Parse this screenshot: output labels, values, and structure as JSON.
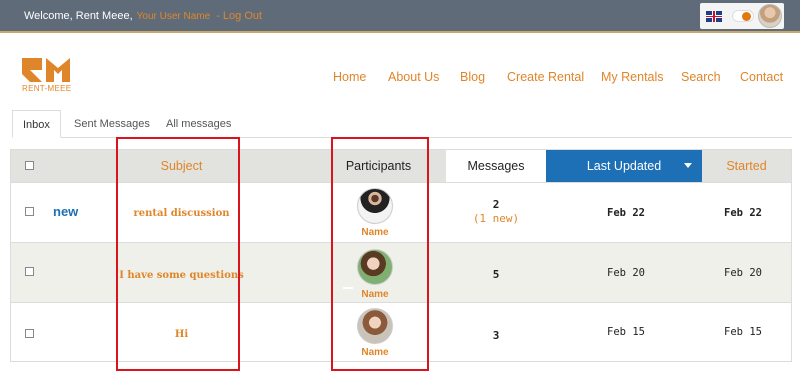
{
  "topbar": {
    "welcome": "Welcome, Rent Meee,",
    "user_name": "Your User Name",
    "logout": "- Log Out"
  },
  "logo": {
    "text": "RENT-MEEE",
    "color": "#e0862a"
  },
  "nav": {
    "items": [
      "Home",
      "About Us",
      "Blog",
      "Create Rental",
      "My Rentals",
      "Search",
      "Contact"
    ]
  },
  "tabs": {
    "items": [
      "Inbox",
      "Sent Messages",
      "All messages"
    ],
    "active": "Inbox"
  },
  "table": {
    "headers": {
      "subject": "Subject",
      "participants": "Participants",
      "messages": "Messages",
      "last_updated": "Last Updated",
      "started": "Started"
    },
    "rows": [
      {
        "badge": "new",
        "subject": "rental discussion",
        "participant": "Name",
        "messages": "2",
        "new_count": "(1 new)",
        "last_updated": "Feb 22",
        "started": "Feb 22"
      },
      {
        "badge": "",
        "subject": "I have some questions",
        "participant": "Name",
        "messages": "5",
        "new_count": "",
        "last_updated": "Feb 20",
        "started": "Feb 20"
      },
      {
        "badge": "",
        "subject": "Hi",
        "participant": "Name",
        "messages": "3",
        "new_count": "",
        "last_updated": "Feb 15",
        "started": "Feb 15"
      }
    ]
  },
  "colors": {
    "accent": "#e0862a",
    "topbar": "#5f6b79",
    "sorted_header": "#1d6fb6",
    "highlight": "#d9141c"
  }
}
